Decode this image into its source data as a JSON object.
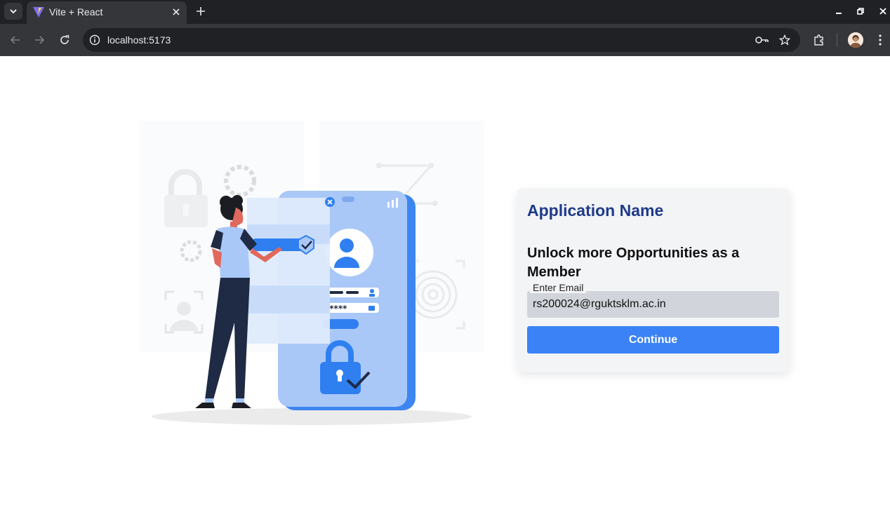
{
  "browser": {
    "tab_title": "Vite + React",
    "url": "localhost:5173"
  },
  "card": {
    "app_name": "Application Name",
    "headline": "Unlock more Opportunities as a Member",
    "email_label": "Enter Email",
    "email_value": "rs200024@rguktsklm.ac.in",
    "continue_label": "Continue"
  },
  "colors": {
    "brand_primary": "#3b82f6",
    "title_color": "#1e3a8a",
    "card_bg": "#f3f4f6",
    "input_bg": "#d1d5db"
  },
  "icons": [
    "tab-list-icon",
    "vite-favicon-icon",
    "close-icon",
    "plus-icon",
    "minimize-icon",
    "restore-icon",
    "close-window-icon",
    "back-icon",
    "forward-icon",
    "reload-icon",
    "site-info-icon",
    "key-icon",
    "star-icon",
    "extensions-icon",
    "profile-avatar",
    "more-menu-icon"
  ]
}
